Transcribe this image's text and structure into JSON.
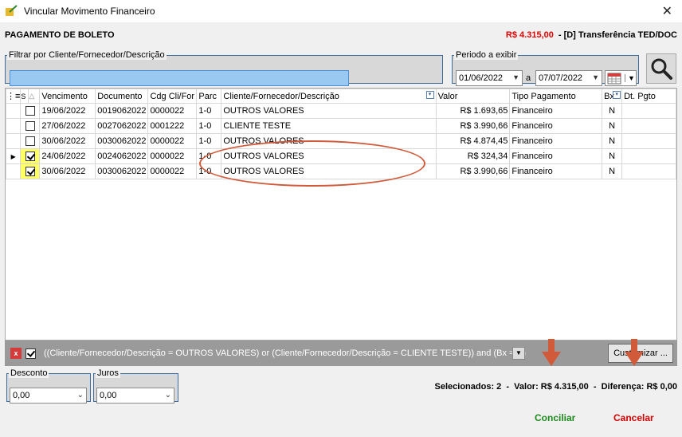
{
  "window": {
    "title": "Vincular Movimento Financeiro"
  },
  "header": {
    "left": "PAGAMENTO DE BOLETO",
    "amount": "R$ 4.315,00",
    "right": "- [D] Transferência TED/DOC"
  },
  "filter": {
    "legend": "Filtrar por Cliente/Fornecedor/Descrição",
    "value": ""
  },
  "period": {
    "legend": "Periodo a exibir",
    "from": "01/06/2022",
    "sep": "a",
    "to": "07/07/2022"
  },
  "grid": {
    "columns": [
      "S",
      "△",
      "Vencimento",
      "Documento",
      "Cdg Cli/For",
      "Parc",
      "Cliente/Fornecedor/Descrição",
      "Valor",
      "Tipo Pagamento",
      "Bx",
      "Dt. Pgto"
    ],
    "rows": [
      {
        "checked": false,
        "vencimento": "19/06/2022",
        "documento": "0019062022",
        "cdg": "0000022",
        "parc": "1-0",
        "cliente": "OUTROS VALORES",
        "valor": "R$ 1.693,65",
        "tipo": "Financeiro",
        "bx": "N",
        "dtpgto": ""
      },
      {
        "checked": false,
        "vencimento": "27/06/2022",
        "documento": "0027062022",
        "cdg": "0001222",
        "parc": "1-0",
        "cliente": "CLIENTE TESTE",
        "valor": "R$ 3.990,66",
        "tipo": "Financeiro",
        "bx": "N",
        "dtpgto": ""
      },
      {
        "checked": false,
        "vencimento": "30/06/2022",
        "documento": "0030062022",
        "cdg": "0000022",
        "parc": "1-0",
        "cliente": "OUTROS VALORES",
        "valor": "R$ 4.874,45",
        "tipo": "Financeiro",
        "bx": "N",
        "dtpgto": ""
      },
      {
        "checked": true,
        "vencimento": "24/06/2022",
        "documento": "0024062022",
        "cdg": "0000022",
        "parc": "1-0",
        "cliente": "OUTROS VALORES",
        "valor": "R$ 324,34",
        "tipo": "Financeiro",
        "bx": "N",
        "dtpgto": ""
      },
      {
        "checked": true,
        "vencimento": "30/06/2022",
        "documento": "0030062022",
        "cdg": "0000022",
        "parc": "1-0",
        "cliente": "OUTROS VALORES",
        "valor": "R$ 3.990,66",
        "tipo": "Financeiro",
        "bx": "N",
        "dtpgto": ""
      }
    ]
  },
  "filterbar": {
    "text": "((Cliente/Fornecedor/Descrição = OUTROS VALORES) or (Cliente/Fornecedor/Descrição = CLIENTE TESTE)) and (Bx = N)",
    "customize": "Customizar ..."
  },
  "desconto": {
    "legend": "Desconto",
    "value": "0,00"
  },
  "juros": {
    "legend": "Juros",
    "value": "0,00"
  },
  "summary": {
    "text": "Selecionados: 2  -  Valor: R$ 4.315,00  -  Diferença: R$ 0,00"
  },
  "buttons": {
    "conciliar": "Conciliar",
    "cancelar": "Cancelar"
  },
  "colors": {
    "highlight": "#ffff66",
    "annotation": "#d05a3a"
  }
}
